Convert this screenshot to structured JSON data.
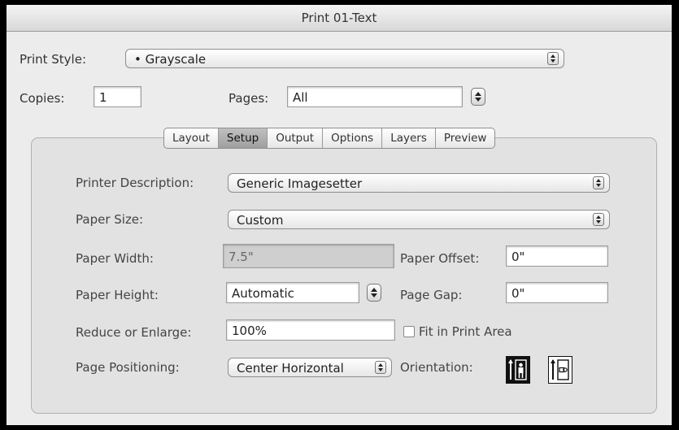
{
  "window": {
    "title": "Print 01-Text"
  },
  "print_style": {
    "label": "Print Style:",
    "value": "• Grayscale"
  },
  "copies": {
    "label": "Copies:",
    "value": "1"
  },
  "pages": {
    "label": "Pages:",
    "value": "All"
  },
  "tabs": [
    {
      "label": "Layout",
      "selected": false
    },
    {
      "label": "Setup",
      "selected": true
    },
    {
      "label": "Output",
      "selected": false
    },
    {
      "label": "Options",
      "selected": false
    },
    {
      "label": "Layers",
      "selected": false
    },
    {
      "label": "Preview",
      "selected": false
    }
  ],
  "setup": {
    "printer_description": {
      "label": "Printer Description:",
      "value": "Generic Imagesetter"
    },
    "paper_size": {
      "label": "Paper Size:",
      "value": "Custom"
    },
    "paper_width": {
      "label": "Paper Width:",
      "value": "7.5\""
    },
    "paper_offset": {
      "label": "Paper Offset:",
      "value": "0\""
    },
    "paper_height": {
      "label": "Paper Height:",
      "value": "Automatic"
    },
    "page_gap": {
      "label": "Page Gap:",
      "value": "0\""
    },
    "reduce_enlarge": {
      "label": "Reduce or Enlarge:",
      "value": "100%"
    },
    "fit_in_print_area": {
      "label": "Fit in Print Area",
      "checked": false
    },
    "page_positioning": {
      "label": "Page Positioning:",
      "value": "Center Horizontal"
    },
    "orientation": {
      "label": "Orientation:",
      "selected": "portrait",
      "options": [
        "portrait",
        "landscape"
      ]
    }
  }
}
